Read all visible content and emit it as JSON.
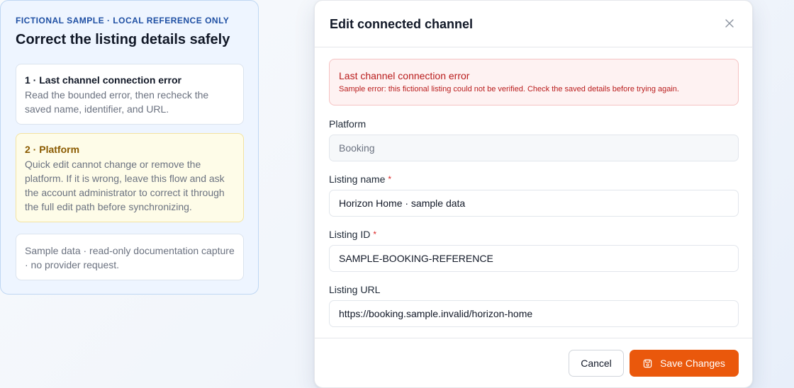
{
  "guide": {
    "eyebrow": "FICTIONAL SAMPLE · LOCAL REFERENCE ONLY",
    "title": "Correct the listing details safely",
    "steps": [
      {
        "title": "1 · Last channel connection error",
        "text": "Read the bounded error, then recheck the saved name, identifier, and URL."
      },
      {
        "title": "2 · Platform",
        "text": "Quick edit cannot change or remove the platform. If it is wrong, leave this flow and ask the account administrator to correct it through the full edit path before synchronizing."
      },
      {
        "text": "Sample data · read-only documentation capture · no provider request."
      }
    ]
  },
  "modal": {
    "title": "Edit connected channel",
    "close_icon": "close-icon",
    "error": {
      "title": "Last channel connection error",
      "text": "Sample error: this fictional listing could not be verified. Check the saved details before trying again."
    },
    "fields": {
      "platform": {
        "label": "Platform",
        "value": "Booking"
      },
      "listing_name": {
        "label": "Listing name",
        "required_mark": "*",
        "value": "Horizon Home · sample data"
      },
      "listing_id": {
        "label": "Listing ID",
        "required_mark": "*",
        "value": "SAMPLE-BOOKING-REFERENCE"
      },
      "listing_url": {
        "label": "Listing URL",
        "value": "https://booking.sample.invalid/horizon-home"
      }
    },
    "footer": {
      "cancel_label": "Cancel",
      "save_label": "Save Changes",
      "save_icon": "save-icon"
    }
  },
  "colors": {
    "accent": "#ea580c",
    "error_text": "#b91c1c",
    "error_bg": "#fef2f2",
    "guide_bg": "#eef5ff",
    "guide_eyebrow": "#1e4fa3",
    "warning_bg": "#fefce8",
    "warning_text": "#8a5a00"
  }
}
